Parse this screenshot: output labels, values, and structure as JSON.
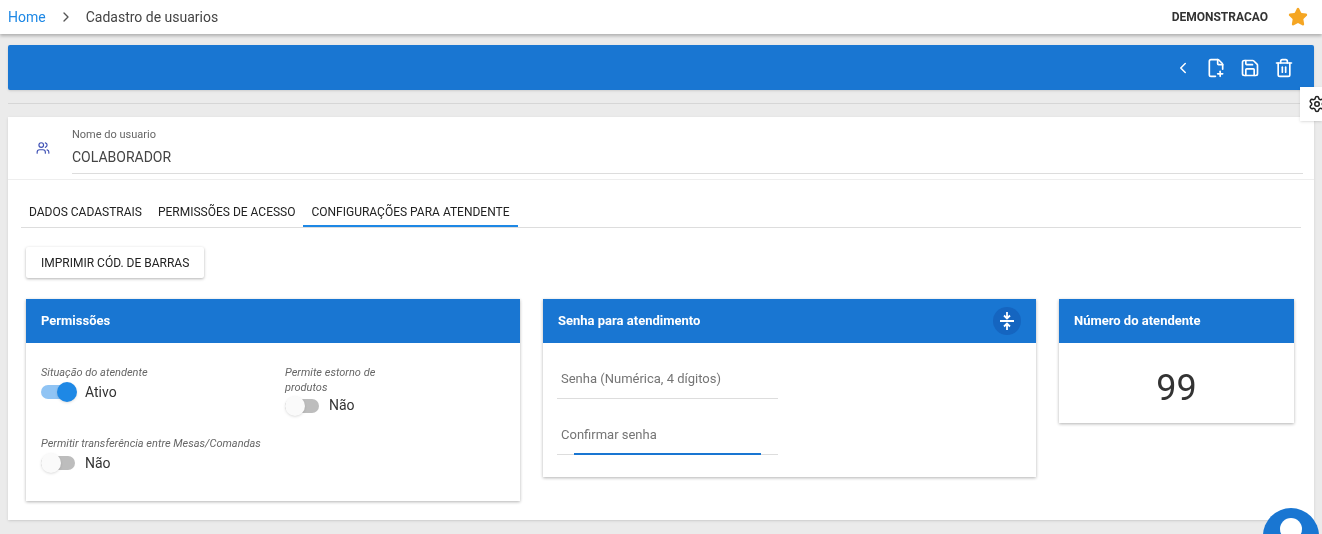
{
  "breadcrumb": {
    "items": [
      "Home",
      "Cadastro de usuarios"
    ]
  },
  "header": {
    "company": "DEMONSTRACAO",
    "favorite": true
  },
  "user": {
    "label": "Nome do usuario",
    "value": "COLABORADOR"
  },
  "tabs": [
    {
      "label": "DADOS CADASTRAIS",
      "selected": false
    },
    {
      "label": "PERMISSÕES DE ACESSO",
      "selected": false
    },
    {
      "label": "CONFIGURAÇÕES PARA ATENDENTE",
      "selected": true
    }
  ],
  "print_button": "IMPRIMIR CÓD. DE BARRAS",
  "permissions": {
    "title": "Permissões",
    "toggles": [
      {
        "label": "Situação do atendente",
        "on": true,
        "state_text": "Ativo"
      },
      {
        "label": "Permite estorno de produtos",
        "on": false,
        "state_text": "Não"
      },
      {
        "label": "Permitir transferência entre Mesas/Comandas",
        "on": false,
        "state_text": "Não"
      }
    ]
  },
  "password": {
    "title": "Senha para atendimento",
    "fields": [
      {
        "placeholder": "Senha (Numérica, 4 dígitos)",
        "focused": false
      },
      {
        "placeholder": "Confirmar senha",
        "focused": true
      }
    ]
  },
  "attendant_number": {
    "title": "Número do atendente",
    "value": "99"
  }
}
